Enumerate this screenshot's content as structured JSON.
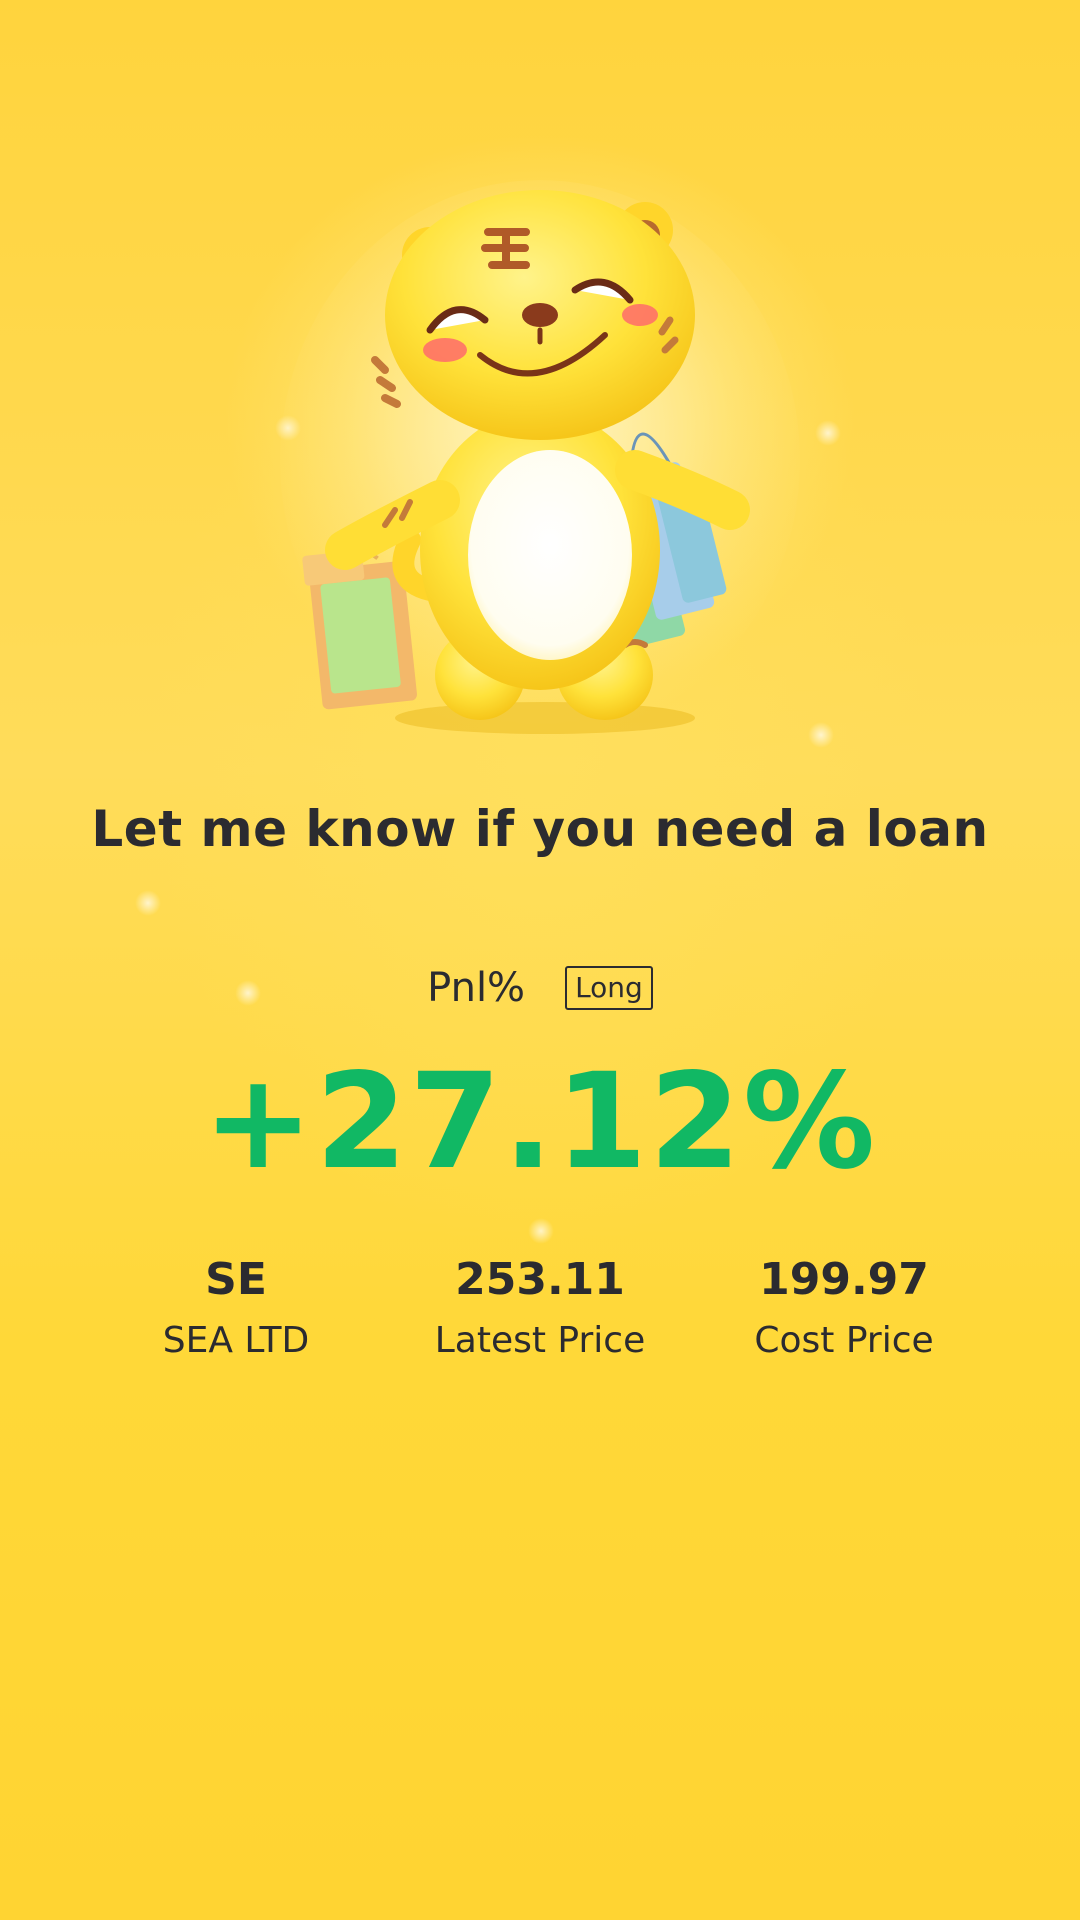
{
  "headline": "Let me know if you need a loan",
  "pnl": {
    "label": "Pnl%",
    "badge": "Long",
    "value": "+27.12%",
    "value_color": "#11b864"
  },
  "stats": [
    {
      "value": "SE",
      "label": "SEA LTD"
    },
    {
      "value": "253.11",
      "label": "Latest Price"
    },
    {
      "value": "199.97",
      "label": "Cost Price"
    }
  ],
  "background_color": "#ffd43a",
  "mascot": {
    "icon": "tiger-mascot-with-shopping-bags"
  }
}
